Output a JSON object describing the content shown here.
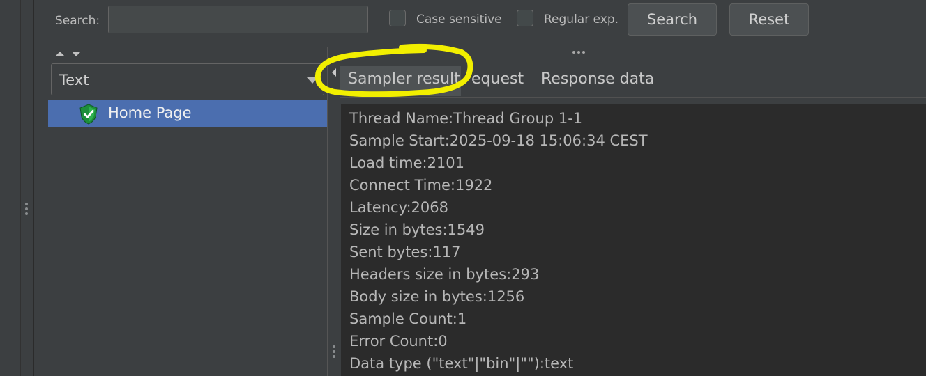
{
  "search": {
    "label": "Search:",
    "value": "",
    "case_sensitive_label": "Case sensitive",
    "regex_label": "Regular exp.",
    "search_button": "Search",
    "reset_button": "Reset"
  },
  "renderer": {
    "selected": "Text"
  },
  "tree": {
    "items": [
      {
        "label": "Home Page",
        "status": "success"
      }
    ]
  },
  "tabs": [
    {
      "label": "Sampler result",
      "selected": true
    },
    {
      "label": "Request",
      "display": "equest"
    },
    {
      "label": "Response data"
    }
  ],
  "sampler_result": {
    "lines": [
      "Thread Name:Thread Group 1-1",
      "Sample Start:2025-09-18 15:06:34 CEST",
      "Load time:2101",
      "Connect Time:1922",
      "Latency:2068",
      "Size in bytes:1549",
      "Sent bytes:117",
      "Headers size in bytes:293",
      "Body size in bytes:1256",
      "Sample Count:1",
      "Error Count:0",
      "Data type (\"text\"|\"bin\"|\"\"):text"
    ]
  },
  "colors": {
    "background": "#3c3f41",
    "selection": "#4b6eaf",
    "content_background": "#2b2b2b",
    "annotation": "#f2ef00"
  }
}
